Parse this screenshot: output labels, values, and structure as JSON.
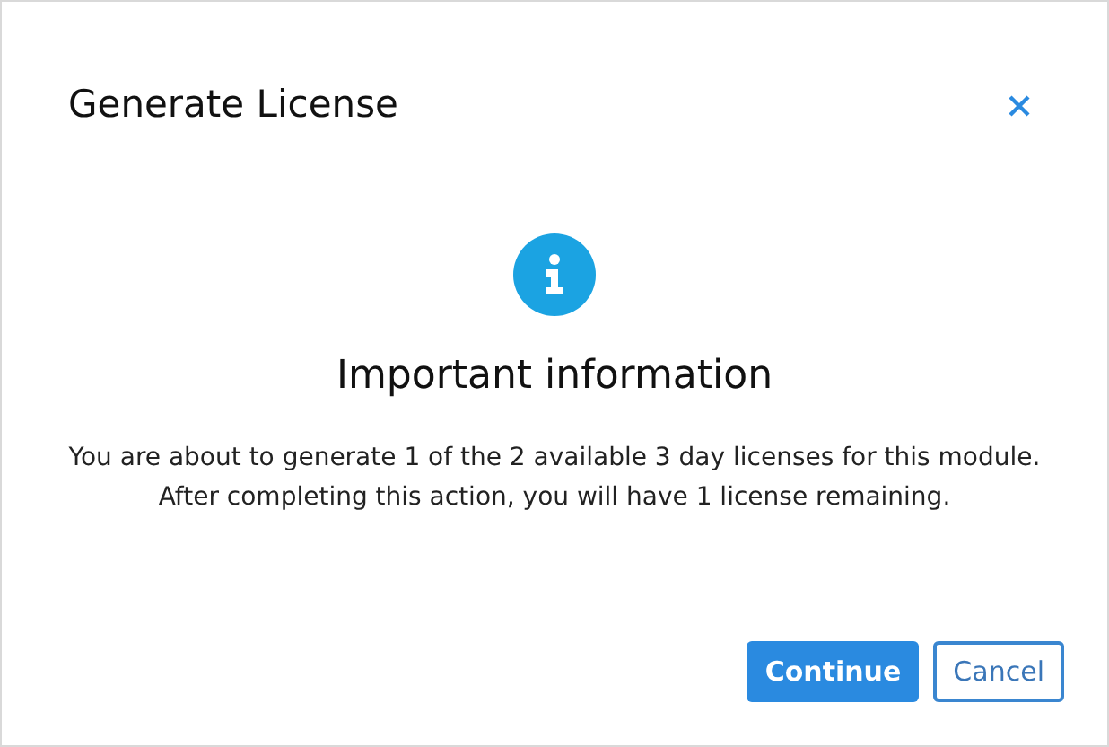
{
  "dialog": {
    "title": "Generate License",
    "heading": "Important information",
    "message": [
      "You are about to generate 1 of the 2 available 3 day licenses for this module.",
      "After completing this action, you will have 1 license remaining."
    ],
    "buttons": [
      {
        "label": "Continue",
        "kind": "primary"
      },
      {
        "label": "Cancel",
        "kind": "secondary"
      }
    ]
  }
}
